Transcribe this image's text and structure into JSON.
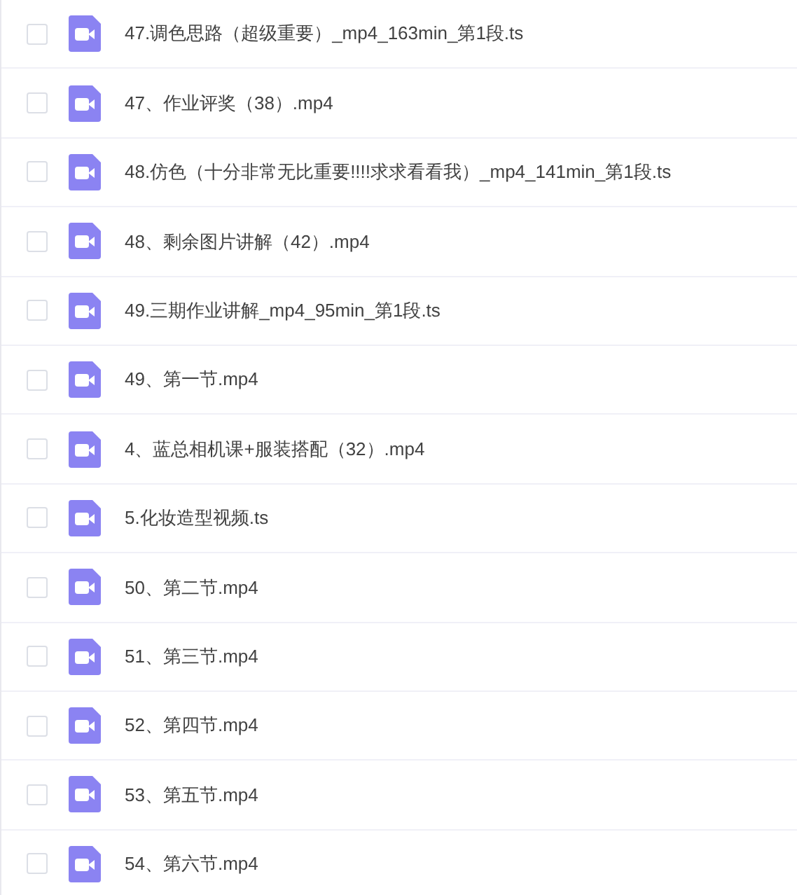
{
  "files": [
    {
      "name": "47.调色思路（超级重要）_mp4_163min_第1段.ts",
      "checked": false
    },
    {
      "name": "47、作业评奖（38）.mp4",
      "checked": false
    },
    {
      "name": "48.仿色（十分非常无比重要!!!!求求看看我）_mp4_141min_第1段.ts",
      "checked": false
    },
    {
      "name": "48、剩余图片讲解（42）.mp4",
      "checked": false
    },
    {
      "name": "49.三期作业讲解_mp4_95min_第1段.ts",
      "checked": false
    },
    {
      "name": "49、第一节.mp4",
      "checked": false
    },
    {
      "name": "4、蓝总相机课+服装搭配（32）.mp4",
      "checked": false
    },
    {
      "name": "5.化妆造型视频.ts",
      "checked": false
    },
    {
      "name": "50、第二节.mp4",
      "checked": false
    },
    {
      "name": "51、第三节.mp4",
      "checked": false
    },
    {
      "name": "52、第四节.mp4",
      "checked": false
    },
    {
      "name": "53、第五节.mp4",
      "checked": false
    },
    {
      "name": "54、第六节.mp4",
      "checked": false
    }
  ]
}
